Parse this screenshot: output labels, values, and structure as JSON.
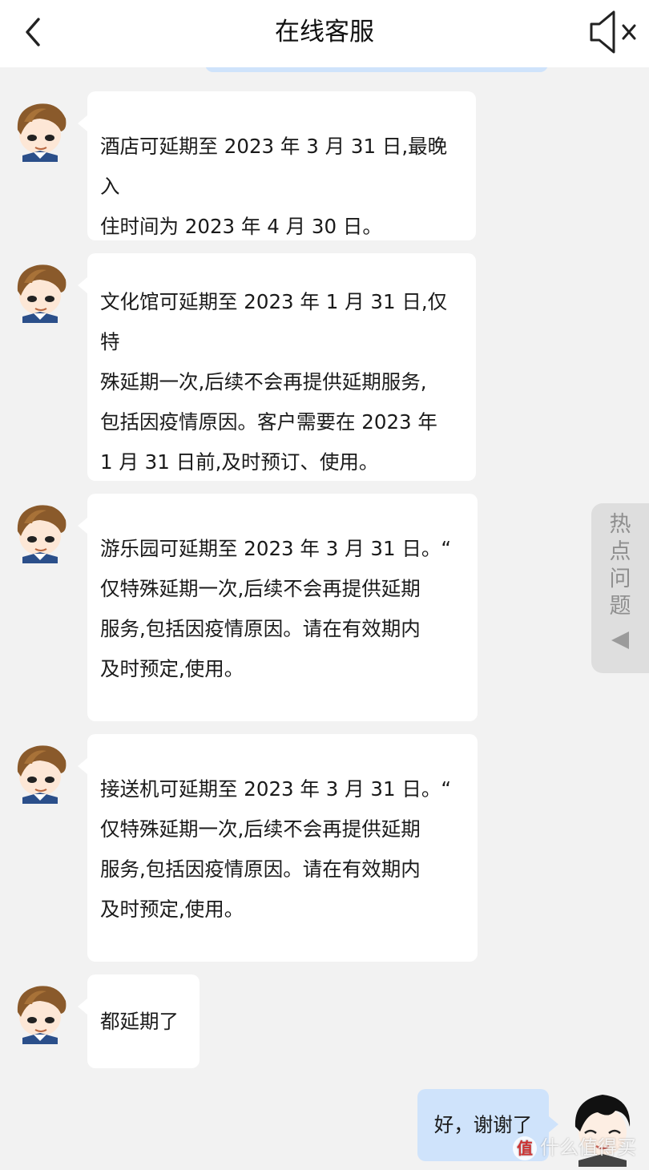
{
  "header": {
    "title": "在线客服",
    "back_icon": "chevron-left-icon",
    "mute_icon": "speaker-mute-icon"
  },
  "messages": [
    {
      "from": "agent",
      "lines": [
        "酒店可延期至 2023 年 3 月 31 日,最晚入",
        "住时间为 2023 年 4 月 30 日。"
      ]
    },
    {
      "from": "agent",
      "lines": [
        "文化馆可延期至 2023 年 1 月 31 日,仅特",
        "殊延期一次,后续不会再提供延期服务,",
        "包括因疫情原因。客户需要在 2023 年",
        "1 月 31 日前,及时预订、使用。"
      ]
    },
    {
      "from": "agent",
      "lines": [
        "游乐园可延期至 2023 年 3 月 31 日。“",
        "仅特殊延期一次,后续不会再提供延期",
        "服务,包括因疫情原因。请在有效期内",
        "及时预定,使用。"
      ]
    },
    {
      "from": "agent",
      "lines": [
        "接送机可延期至 2023 年 3 月 31 日。“",
        "仅特殊延期一次,后续不会再提供延期",
        "服务,包括因疫情原因。请在有效期内",
        "及时预定,使用。"
      ]
    },
    {
      "from": "agent",
      "lines": [
        "都延期了"
      ]
    },
    {
      "from": "user",
      "lines": [
        "好，谢谢了"
      ]
    }
  ],
  "hot_questions": {
    "label_chars": [
      "热",
      "点",
      "问",
      "题"
    ],
    "arrow_icon": "triangle-left-icon"
  },
  "watermark": {
    "logo_char": "值",
    "text": "什么值得买"
  },
  "colors": {
    "header_bg": "#ffffff",
    "page_bg": "#f2f2f2",
    "agent_bubble": "#ffffff",
    "user_bubble": "#cfe3fb",
    "hot_tab_bg": "#dedede"
  }
}
